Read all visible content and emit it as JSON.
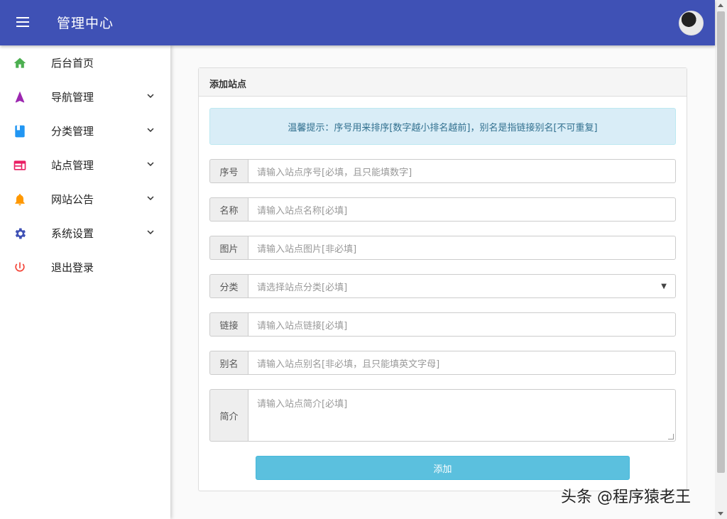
{
  "header": {
    "title": "管理中心"
  },
  "sidebar": {
    "items": [
      {
        "label": "后台首页",
        "icon": "home-icon",
        "color": "#4caf50",
        "expandable": false
      },
      {
        "label": "导航管理",
        "icon": "navigation-icon",
        "color": "#9c27b0",
        "expandable": true
      },
      {
        "label": "分类管理",
        "icon": "book-icon",
        "color": "#2196f3",
        "expandable": true
      },
      {
        "label": "站点管理",
        "icon": "web-icon",
        "color": "#e91e63",
        "expandable": true
      },
      {
        "label": "网站公告",
        "icon": "bell-icon",
        "color": "#ff9800",
        "expandable": true
      },
      {
        "label": "系统设置",
        "icon": "gear-icon",
        "color": "#3f51b5",
        "expandable": true
      },
      {
        "label": "退出登录",
        "icon": "power-icon",
        "color": "#f44336",
        "expandable": false
      }
    ]
  },
  "card": {
    "title": "添加站点",
    "alert": "温馨提示：序号用来排序[数字越小排名越前]，别名是指链接别名[不可重复]"
  },
  "form": {
    "order": {
      "label": "序号",
      "placeholder": "请输入站点序号[必填，且只能填数字]"
    },
    "name": {
      "label": "名称",
      "placeholder": "请输入站点名称[必填]"
    },
    "image": {
      "label": "图片",
      "placeholder": "请输入站点图片[非必填]"
    },
    "category": {
      "label": "分类",
      "placeholder": "请选择站点分类[必填]"
    },
    "link": {
      "label": "链接",
      "placeholder": "请输入站点链接[必填]"
    },
    "alias": {
      "label": "别名",
      "placeholder": "请输入站点别名[非必填，且只能填英文字母]"
    },
    "intro": {
      "label": "简介",
      "placeholder": "请输入站点简介[必填]"
    },
    "submit_label": "添加"
  },
  "watermark": "头条 @程序猿老王",
  "colors": {
    "primary": "#3f51b5",
    "info": "#5bc0de",
    "alert_bg": "#d9edf7",
    "alert_text": "#31708f"
  }
}
